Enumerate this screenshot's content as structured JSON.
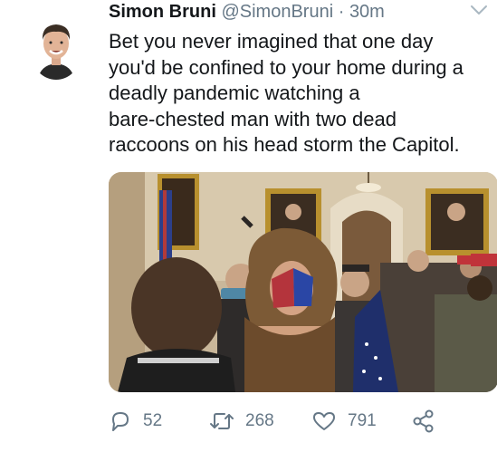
{
  "tweet": {
    "author": {
      "display_name": "Simon Bruni",
      "handle": "@SimonBruni",
      "separator": "·",
      "time": "30m",
      "avatar_icon": "profile-photo"
    },
    "menu_icon": "chevron-down-icon",
    "text_lines": [
      "Bet you never imagined that one day",
      "you'd be confined to your home during a",
      "deadly pandemic watching a",
      "bare-chested man with two dead",
      "raccoons on his head storm the Capitol."
    ],
    "media": {
      "type": "photo",
      "icon": "photo-image"
    },
    "actions": {
      "reply": {
        "icon": "reply-icon",
        "count": "52"
      },
      "retweet": {
        "icon": "retweet-icon",
        "count": "268"
      },
      "like": {
        "icon": "heart-icon",
        "count": "791"
      },
      "share": {
        "icon": "share-icon"
      }
    },
    "colors": {
      "text": "#14171a",
      "secondary": "#657786"
    }
  }
}
